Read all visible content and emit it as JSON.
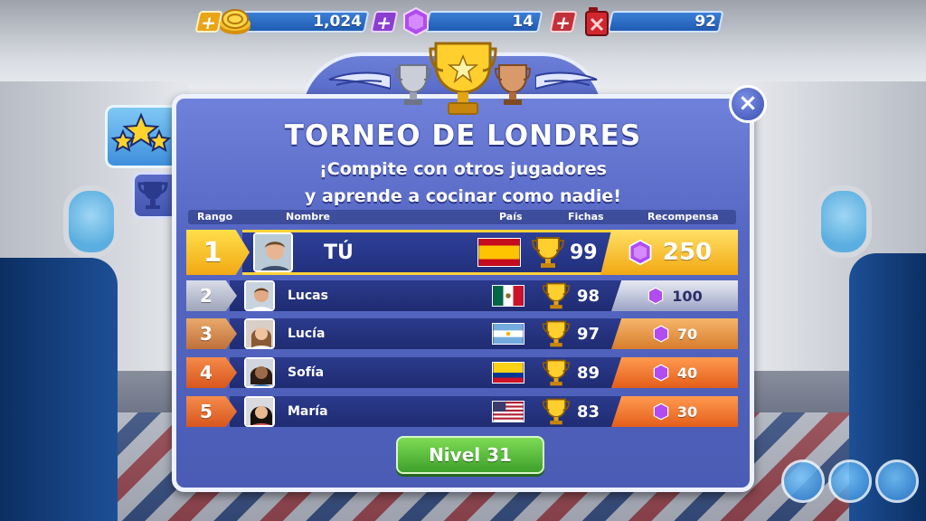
{
  "currencies": {
    "coins": {
      "value": "1,024",
      "plus": "+",
      "icon": "coin-stack-icon"
    },
    "gems": {
      "value": "14",
      "plus": "+",
      "icon": "purple-gem-icon"
    },
    "fuel": {
      "value": "92",
      "plus": "+",
      "icon": "red-fuel-can-icon"
    }
  },
  "panel": {
    "title": "TORNEO DE LONDRES",
    "subtitle_line1": "¡Compite con otros jugadores",
    "subtitle_line2": "y aprende a cocinar como nadie!",
    "close_symbol": "×"
  },
  "table": {
    "headers": {
      "rank": "Rango",
      "name": "Nombre",
      "country": "País",
      "tokens": "Fichas",
      "reward": "Recompensa"
    },
    "rows": [
      {
        "rank": "1",
        "name": "TÚ",
        "flag": "spain-flag",
        "score": "99",
        "reward": "250"
      },
      {
        "rank": "2",
        "name": "Lucas",
        "flag": "mexico-flag",
        "score": "98",
        "reward": "100"
      },
      {
        "rank": "3",
        "name": "Lucía",
        "flag": "argentina-flag",
        "score": "97",
        "reward": "70"
      },
      {
        "rank": "4",
        "name": "Sofía",
        "flag": "colombia-flag",
        "score": "89",
        "reward": "40"
      },
      {
        "rank": "5",
        "name": "María",
        "flag": "usa-flag",
        "score": "83",
        "reward": "30"
      }
    ]
  },
  "level_button": {
    "label": "Nivel 31"
  },
  "colors": {
    "panel": "#5567c3",
    "gold": "#f2a813",
    "silver": "#9ea5ba",
    "bronze": "#c0703a",
    "orange": "#e45e1a",
    "green_button": "#3da02a"
  }
}
